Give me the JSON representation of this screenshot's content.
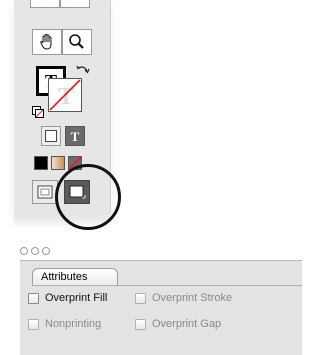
{
  "attributes_panel": {
    "tab_label": "Attributes",
    "options": [
      {
        "label": "Overprint Fill",
        "checked": false,
        "enabled": true
      },
      {
        "label": "Overprint Stroke",
        "checked": false,
        "enabled": false
      },
      {
        "label": "Nonprinting",
        "checked": false,
        "enabled": false
      },
      {
        "label": "Overprint Gap",
        "checked": false,
        "enabled": false
      }
    ]
  },
  "tools_palette": {
    "tools": [
      "hand-tool",
      "zoom-tool"
    ],
    "fill_stroke_letter": "T",
    "highlighted_control": "normal-view-mode"
  },
  "colors": {
    "panel_background": "#e3e3e3",
    "tool_background": "#e6e6e6",
    "highlight_circle": "#111111",
    "stroke_none_red": "#d62828"
  }
}
